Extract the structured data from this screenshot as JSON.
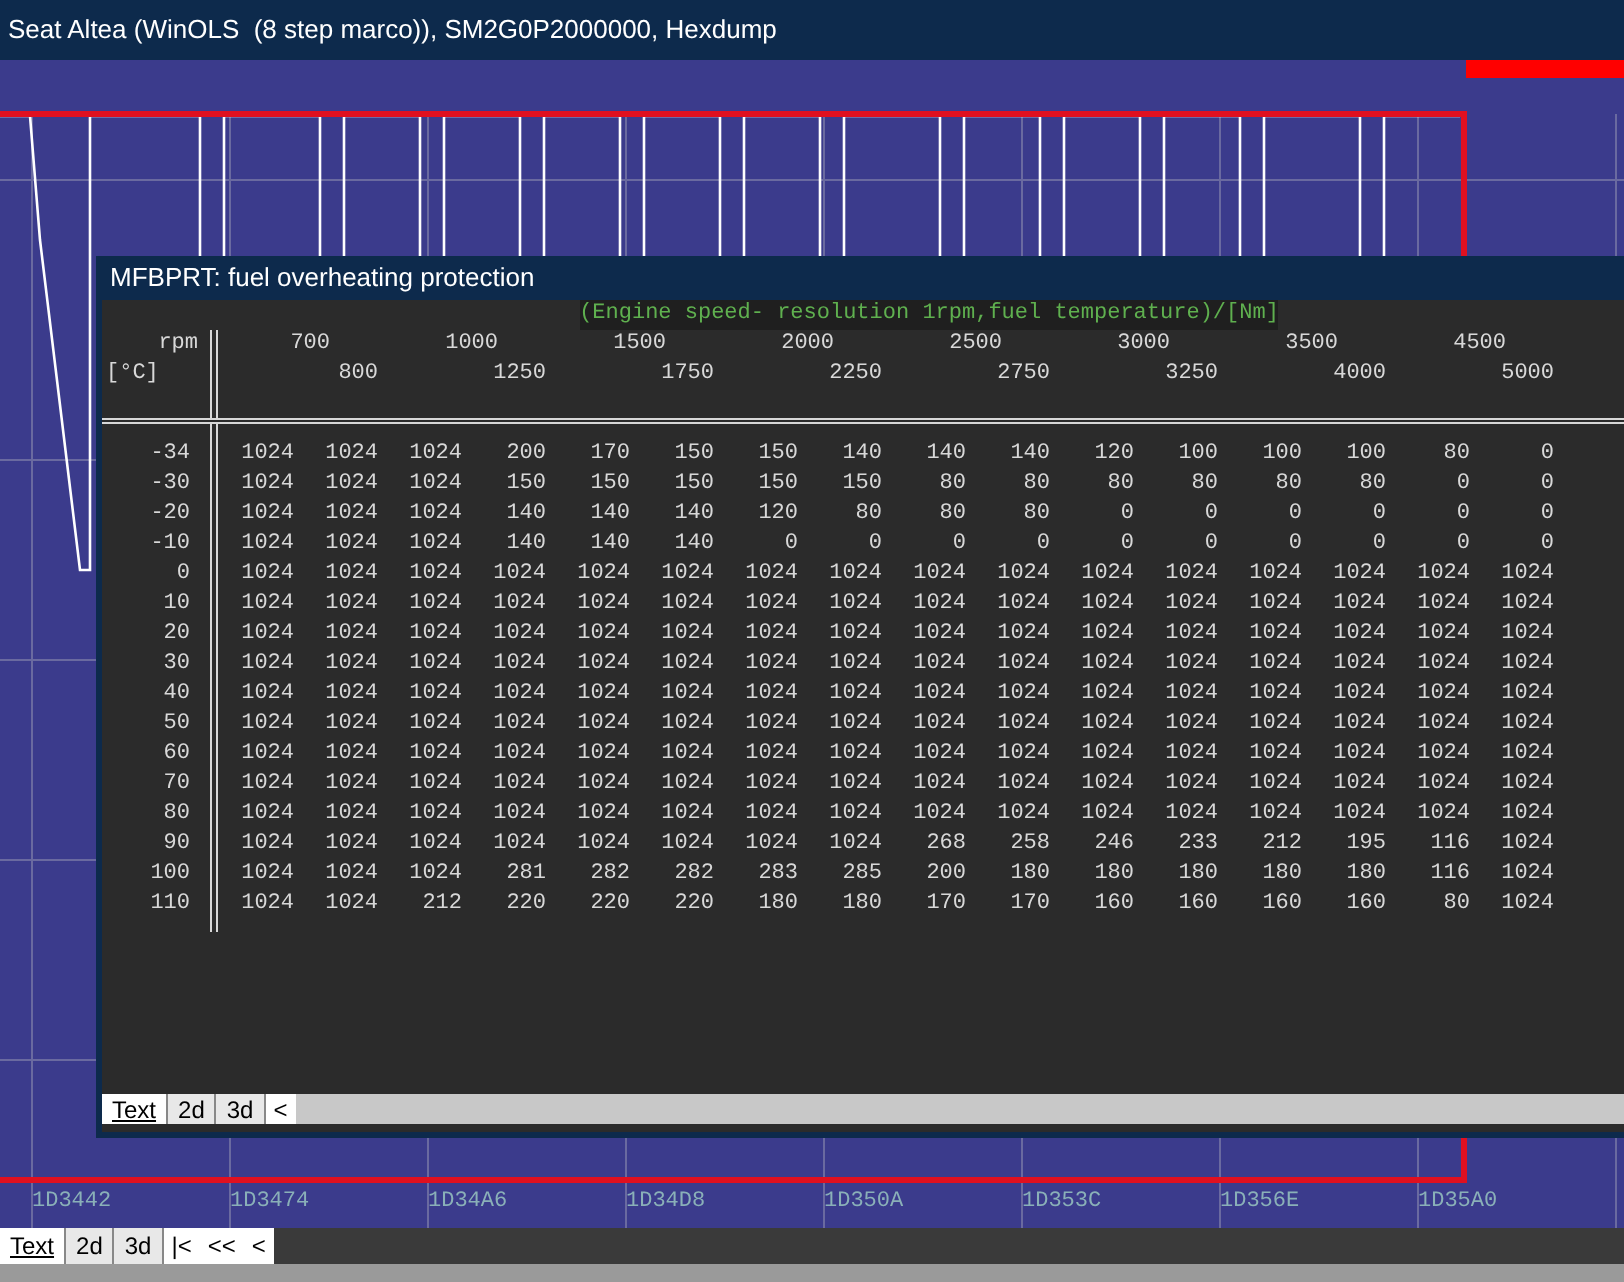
{
  "window": {
    "title": "Seat Altea (WinOLS  (8 step marco)), SM2G0P2000000, Hexdump"
  },
  "hexdump": {
    "addresses": [
      "1D3442",
      "1D3474",
      "1D34A6",
      "1D34D8",
      "1D350A",
      "1D353C",
      "1D356E",
      "1D35A0"
    ],
    "tabs": [
      {
        "label": "Text",
        "selected": true
      },
      {
        "label": "2d",
        "selected": false
      },
      {
        "label": "3d",
        "selected": false
      }
    ],
    "nav_buttons": [
      "|<",
      "<<",
      "<"
    ]
  },
  "map_window": {
    "title": "MFBPRT: fuel overheating protection",
    "axis_title": "(Engine speed- resolution 1rpm,fuel temperature)/[Nm]",
    "x_label": "rpm",
    "y_label": "[°C]",
    "columns": [
      "700",
      "800",
      "1000",
      "1250",
      "1500",
      "1750",
      "2000",
      "2250",
      "2500",
      "2750",
      "3000",
      "3250",
      "3500",
      "4000",
      "4500",
      "5000"
    ],
    "rows": [
      {
        "label": "-34",
        "values": [
          "1024",
          "1024",
          "1024",
          "200",
          "170",
          "150",
          "150",
          "140",
          "140",
          "140",
          "120",
          "100",
          "100",
          "100",
          "80",
          "0"
        ]
      },
      {
        "label": "-30",
        "values": [
          "1024",
          "1024",
          "1024",
          "150",
          "150",
          "150",
          "150",
          "150",
          "80",
          "80",
          "80",
          "80",
          "80",
          "80",
          "0",
          "0"
        ]
      },
      {
        "label": "-20",
        "values": [
          "1024",
          "1024",
          "1024",
          "140",
          "140",
          "140",
          "120",
          "80",
          "80",
          "80",
          "0",
          "0",
          "0",
          "0",
          "0",
          "0"
        ]
      },
      {
        "label": "-10",
        "values": [
          "1024",
          "1024",
          "1024",
          "140",
          "140",
          "140",
          "0",
          "0",
          "0",
          "0",
          "0",
          "0",
          "0",
          "0",
          "0",
          "0"
        ]
      },
      {
        "label": "0",
        "values": [
          "1024",
          "1024",
          "1024",
          "1024",
          "1024",
          "1024",
          "1024",
          "1024",
          "1024",
          "1024",
          "1024",
          "1024",
          "1024",
          "1024",
          "1024",
          "1024"
        ]
      },
      {
        "label": "10",
        "values": [
          "1024",
          "1024",
          "1024",
          "1024",
          "1024",
          "1024",
          "1024",
          "1024",
          "1024",
          "1024",
          "1024",
          "1024",
          "1024",
          "1024",
          "1024",
          "1024"
        ]
      },
      {
        "label": "20",
        "values": [
          "1024",
          "1024",
          "1024",
          "1024",
          "1024",
          "1024",
          "1024",
          "1024",
          "1024",
          "1024",
          "1024",
          "1024",
          "1024",
          "1024",
          "1024",
          "1024"
        ]
      },
      {
        "label": "30",
        "values": [
          "1024",
          "1024",
          "1024",
          "1024",
          "1024",
          "1024",
          "1024",
          "1024",
          "1024",
          "1024",
          "1024",
          "1024",
          "1024",
          "1024",
          "1024",
          "1024"
        ]
      },
      {
        "label": "40",
        "values": [
          "1024",
          "1024",
          "1024",
          "1024",
          "1024",
          "1024",
          "1024",
          "1024",
          "1024",
          "1024",
          "1024",
          "1024",
          "1024",
          "1024",
          "1024",
          "1024"
        ]
      },
      {
        "label": "50",
        "values": [
          "1024",
          "1024",
          "1024",
          "1024",
          "1024",
          "1024",
          "1024",
          "1024",
          "1024",
          "1024",
          "1024",
          "1024",
          "1024",
          "1024",
          "1024",
          "1024"
        ]
      },
      {
        "label": "60",
        "values": [
          "1024",
          "1024",
          "1024",
          "1024",
          "1024",
          "1024",
          "1024",
          "1024",
          "1024",
          "1024",
          "1024",
          "1024",
          "1024",
          "1024",
          "1024",
          "1024"
        ]
      },
      {
        "label": "70",
        "values": [
          "1024",
          "1024",
          "1024",
          "1024",
          "1024",
          "1024",
          "1024",
          "1024",
          "1024",
          "1024",
          "1024",
          "1024",
          "1024",
          "1024",
          "1024",
          "1024"
        ]
      },
      {
        "label": "80",
        "values": [
          "1024",
          "1024",
          "1024",
          "1024",
          "1024",
          "1024",
          "1024",
          "1024",
          "1024",
          "1024",
          "1024",
          "1024",
          "1024",
          "1024",
          "1024",
          "1024"
        ]
      },
      {
        "label": "90",
        "values": [
          "1024",
          "1024",
          "1024",
          "1024",
          "1024",
          "1024",
          "1024",
          "1024",
          "268",
          "258",
          "246",
          "233",
          "212",
          "195",
          "116",
          "1024"
        ]
      },
      {
        "label": "100",
        "values": [
          "1024",
          "1024",
          "1024",
          "281",
          "282",
          "282",
          "283",
          "285",
          "200",
          "180",
          "180",
          "180",
          "180",
          "180",
          "116",
          "1024"
        ]
      },
      {
        "label": "110",
        "values": [
          "1024",
          "1024",
          "212",
          "220",
          "220",
          "220",
          "180",
          "180",
          "170",
          "170",
          "160",
          "160",
          "160",
          "160",
          "80",
          "1024"
        ]
      }
    ],
    "tabs": [
      {
        "label": "Text",
        "selected": true
      },
      {
        "label": "2d",
        "selected": false
      },
      {
        "label": "3d",
        "selected": false
      }
    ],
    "nav_buttons": [
      "<"
    ]
  }
}
